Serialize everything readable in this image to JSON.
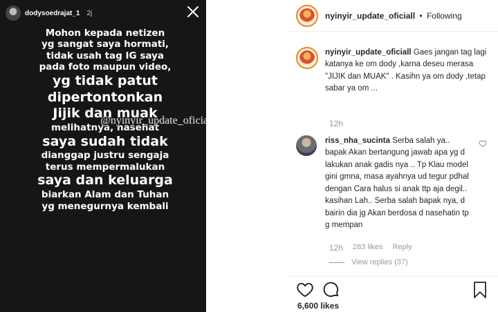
{
  "story": {
    "username": "dodysoedrajat_1",
    "time": "2j",
    "lines": [
      {
        "text": "Mohon kepada netizen",
        "size": "s"
      },
      {
        "text": "yg sangat saya hormati,",
        "size": "s"
      },
      {
        "text": "tidak usah tag IG saya",
        "size": "s"
      },
      {
        "text": "pada foto maupun video,",
        "size": "s"
      },
      {
        "text": "yg tidak patut",
        "size": "l"
      },
      {
        "text": "dipertontonkan",
        "size": "l"
      },
      {
        "text": "Jijik dan muak",
        "size": "l"
      },
      {
        "text": "melihatnya, nasehat",
        "size": "s"
      },
      {
        "text": "saya sudah tidak",
        "size": "l"
      },
      {
        "text": "dianggap justru sengaja",
        "size": "s"
      },
      {
        "text": "terus mempermalukan",
        "size": "s"
      },
      {
        "text": "saya dan keluarga",
        "size": "l"
      },
      {
        "text": "biarkan Alam dan Tuhan",
        "size": "s"
      },
      {
        "text": "yg menegurnya kembali",
        "size": "s"
      }
    ],
    "watermark": "@nyinyir_update_oficiall"
  },
  "post": {
    "header": {
      "username": "nyinyir_update_oficiall",
      "separator": "•",
      "follow_label": "Following"
    },
    "caption": {
      "username": "nyinyir_update_oficiall",
      "text": "Gaes jangan tag lagi katanya ke om dody ,karna deseu merasa \"JIJIK dan MUAK\" . Kasihn ya om dody ,tetap sabar ya om ...",
      "time": "12h"
    },
    "comment": {
      "username": "riss_nha_sucinta",
      "text": "Serba salah ya.. bapak Akan bertangung jawab apa yg d lakukan anak gadis nya .. Tp Klau model gini gmna, masa ayahnya ud tegur pdhal dengan Cara halus si anak ttp aja degil.. kasihan Lah.. Serba salah bapak nya, d bairin dia jg Akan berdosa d nasehatin tp g mempan",
      "time": "12h",
      "likes": "283 likes",
      "reply_label": "Reply",
      "view_replies": "View replies (37)"
    },
    "likes": "6,600 likes",
    "icons": {
      "close": "close-icon",
      "heart": "heart-icon",
      "comment": "comment-icon",
      "bookmark": "bookmark-icon"
    }
  }
}
